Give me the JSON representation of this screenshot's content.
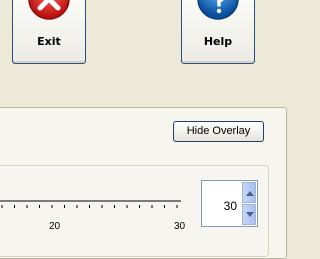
{
  "buttons": {
    "exit_label": "Exit",
    "help_label": "Help"
  },
  "overlay": {
    "hide_label": "Hide Overlay"
  },
  "ruler": {
    "labels": [
      "20",
      "30"
    ]
  },
  "spinner": {
    "value": "30"
  },
  "colors": {
    "exit_red": "#e21c1c",
    "help_blue": "#1d6fc9",
    "button_border": "#2a4f86"
  }
}
